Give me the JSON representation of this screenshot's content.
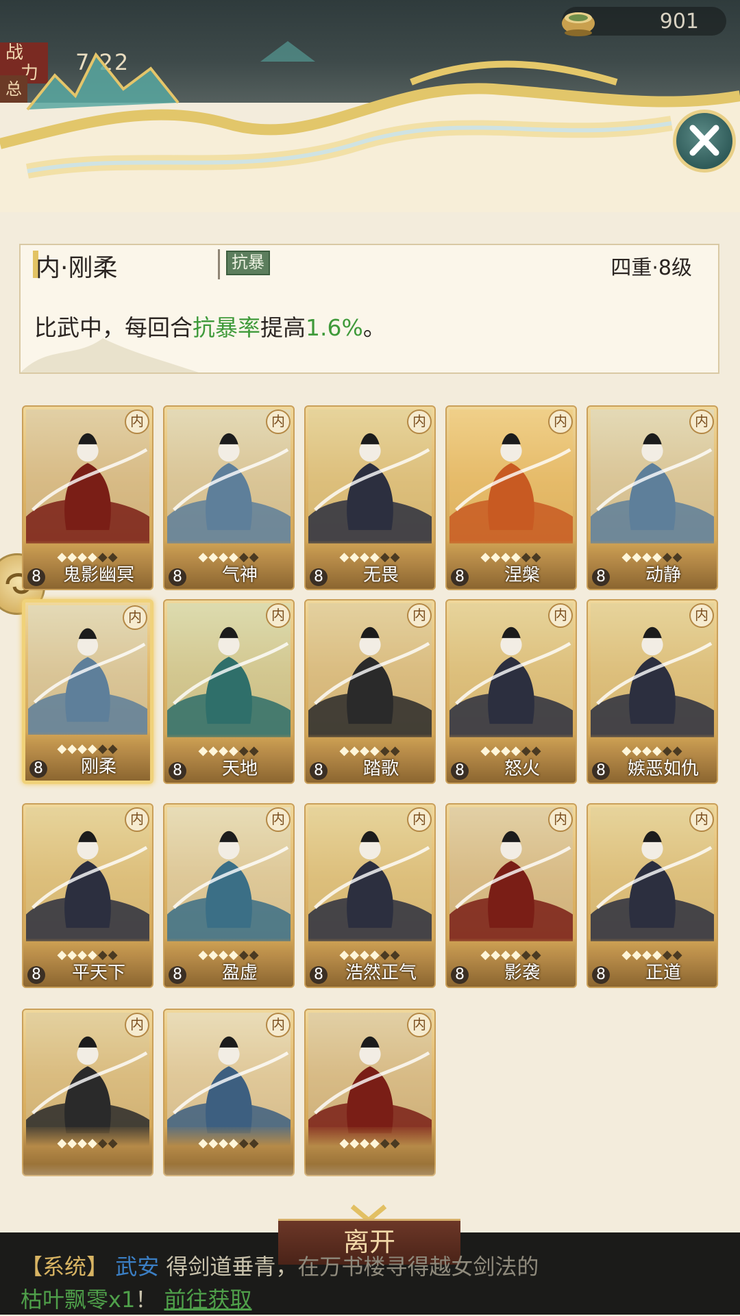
{
  "currency": {
    "icon": "tea-cup-icon",
    "value": "901"
  },
  "power": {
    "label_top": "战",
    "label_bottom": "力",
    "value": "7  22",
    "label_side": "总"
  },
  "info": {
    "skill_name": "内·刚柔",
    "tag": "抗暴",
    "level": "四重·8级",
    "desc_prefix": "比武中，每回合",
    "desc_highlight": "抗暴率",
    "desc_mid": "提高",
    "desc_value": "1.6%",
    "desc_suffix": "。"
  },
  "cards": [
    {
      "name": "鬼影幽冥",
      "level": "8",
      "badge": "内",
      "stars": 4,
      "max_stars": 6,
      "selected": false
    },
    {
      "name": "气神",
      "level": "8",
      "badge": "内",
      "stars": 4,
      "max_stars": 6,
      "selected": false
    },
    {
      "name": "无畏",
      "level": "8",
      "badge": "内",
      "stars": 4,
      "max_stars": 6,
      "selected": false
    },
    {
      "name": "涅槃",
      "level": "8",
      "badge": "内",
      "stars": 4,
      "max_stars": 6,
      "selected": false
    },
    {
      "name": "动静",
      "level": "8",
      "badge": "内",
      "stars": 4,
      "max_stars": 6,
      "selected": false
    },
    {
      "name": "刚柔",
      "level": "8",
      "badge": "内",
      "stars": 4,
      "max_stars": 6,
      "selected": true
    },
    {
      "name": "天地",
      "level": "8",
      "badge": "内",
      "stars": 4,
      "max_stars": 6,
      "selected": false
    },
    {
      "name": "踏歌",
      "level": "8",
      "badge": "内",
      "stars": 4,
      "max_stars": 6,
      "selected": false
    },
    {
      "name": "怒火",
      "level": "8",
      "badge": "内",
      "stars": 4,
      "max_stars": 6,
      "selected": false
    },
    {
      "name": "嫉恶如仇",
      "level": "8",
      "badge": "内",
      "stars": 4,
      "max_stars": 6,
      "selected": false
    },
    {
      "name": "平天下",
      "level": "8",
      "badge": "内",
      "stars": 4,
      "max_stars": 6,
      "selected": false
    },
    {
      "name": "盈虚",
      "level": "8",
      "badge": "内",
      "stars": 4,
      "max_stars": 6,
      "selected": false
    },
    {
      "name": "浩然正气",
      "level": "8",
      "badge": "内",
      "stars": 4,
      "max_stars": 6,
      "selected": false
    },
    {
      "name": "影袭",
      "level": "8",
      "badge": "内",
      "stars": 4,
      "max_stars": 6,
      "selected": false
    },
    {
      "name": "正道",
      "level": "8",
      "badge": "内",
      "stars": 4,
      "max_stars": 6,
      "selected": false
    },
    {
      "name": "",
      "level": "",
      "badge": "内",
      "stars": 4,
      "max_stars": 6,
      "selected": false
    },
    {
      "name": "",
      "level": "",
      "badge": "内",
      "stars": 4,
      "max_stars": 6,
      "selected": false
    },
    {
      "name": "",
      "level": "",
      "badge": "内",
      "stars": 4,
      "max_stars": 6,
      "selected": false
    }
  ],
  "leave_button": "离开",
  "chat": {
    "system_tag": "【系统】",
    "player": "武安",
    "text1": "得剑道垂青，",
    "text2": "在万书楼寻得越女剑法的",
    "item": "枯叶飘零x1",
    "text3": "！",
    "link": "前往获取"
  },
  "colors": {
    "highlight_green": "#3f9a3a",
    "card_gold": "#c89a4a",
    "selected_border": "#f0d27a"
  }
}
